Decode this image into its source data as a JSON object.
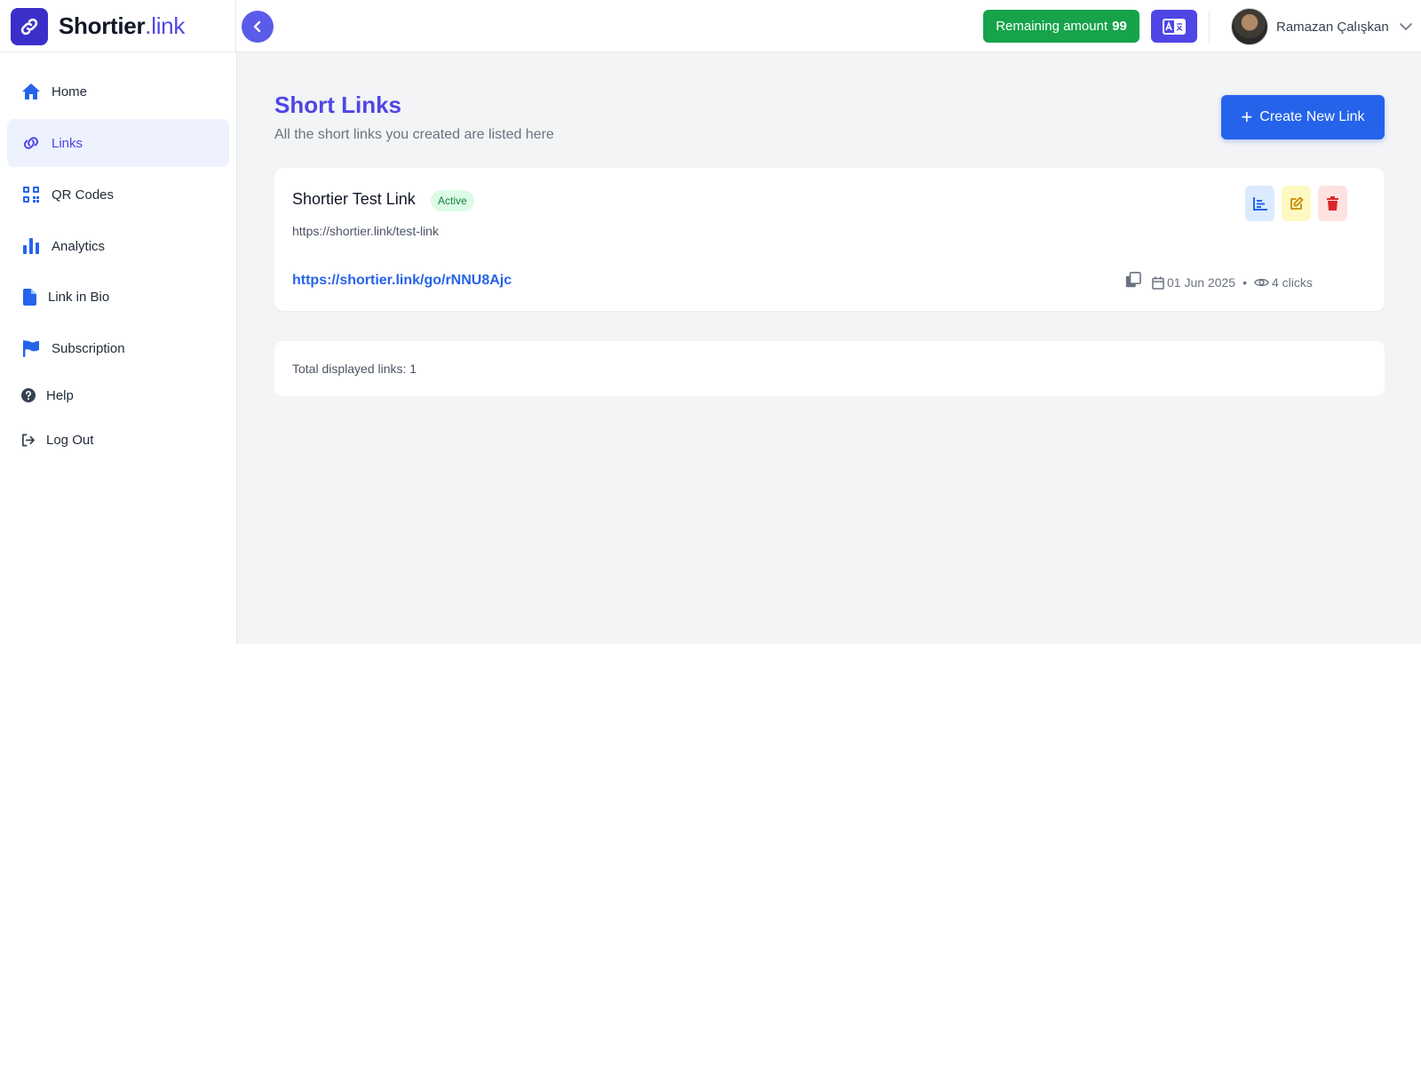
{
  "brand": {
    "name_main": "Shortier",
    "name_tld": ".link"
  },
  "header": {
    "remaining_label": "Remaining amount",
    "remaining_value": "99",
    "user_name": "Ramazan Çalışkan"
  },
  "sidebar": {
    "items": [
      {
        "label": "Home",
        "icon": "home-icon"
      },
      {
        "label": "Links",
        "icon": "link-icon",
        "active": true
      },
      {
        "label": "QR Codes",
        "icon": "qr-code-icon"
      },
      {
        "label": "Analytics",
        "icon": "bar-chart-icon"
      },
      {
        "label": "Link in Bio",
        "icon": "file-icon"
      },
      {
        "label": "Subscription",
        "icon": "flag-icon"
      },
      {
        "label": "Help",
        "icon": "question-circle-icon"
      },
      {
        "label": "Log Out",
        "icon": "sign-out-icon"
      }
    ]
  },
  "main": {
    "title": "Short Links",
    "subtitle": "All the short links you created are listed here",
    "create_button": "Create New Link",
    "links": [
      {
        "title": "Shortier Test Link",
        "status": "Active",
        "original_url": "https://shortier.link/test-link",
        "short_url": "https://shortier.link/go/rNNU8Ajc",
        "date": "01 Jun 2025",
        "separator": "•",
        "clicks": "4 clicks"
      }
    ],
    "total_label": "Total displayed links: 1"
  },
  "colors": {
    "accent": "#4f46e5",
    "primary_button": "#2563eb",
    "success": "#16a34a",
    "background": "#f3f4f6"
  }
}
